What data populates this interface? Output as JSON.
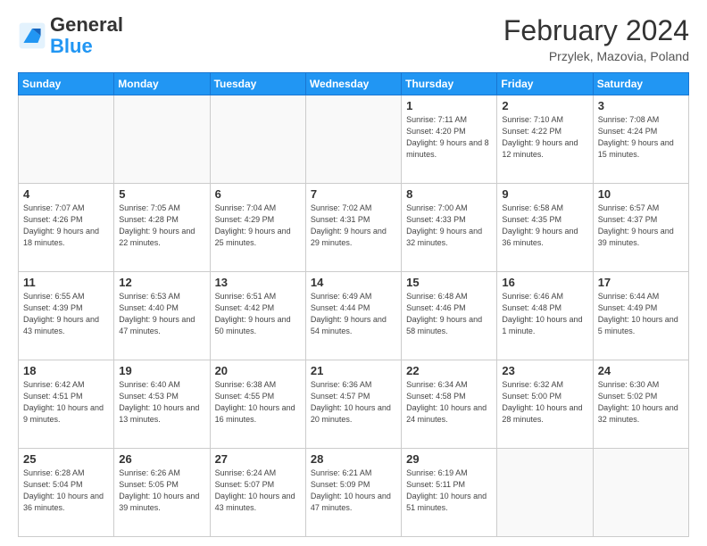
{
  "header": {
    "logo_general": "General",
    "logo_blue": "Blue",
    "month_year": "February 2024",
    "location": "Przylek, Mazovia, Poland"
  },
  "weekdays": [
    "Sunday",
    "Monday",
    "Tuesday",
    "Wednesday",
    "Thursday",
    "Friday",
    "Saturday"
  ],
  "weeks": [
    [
      {
        "day": "",
        "info": ""
      },
      {
        "day": "",
        "info": ""
      },
      {
        "day": "",
        "info": ""
      },
      {
        "day": "",
        "info": ""
      },
      {
        "day": "1",
        "info": "Sunrise: 7:11 AM\nSunset: 4:20 PM\nDaylight: 9 hours\nand 8 minutes."
      },
      {
        "day": "2",
        "info": "Sunrise: 7:10 AM\nSunset: 4:22 PM\nDaylight: 9 hours\nand 12 minutes."
      },
      {
        "day": "3",
        "info": "Sunrise: 7:08 AM\nSunset: 4:24 PM\nDaylight: 9 hours\nand 15 minutes."
      }
    ],
    [
      {
        "day": "4",
        "info": "Sunrise: 7:07 AM\nSunset: 4:26 PM\nDaylight: 9 hours\nand 18 minutes."
      },
      {
        "day": "5",
        "info": "Sunrise: 7:05 AM\nSunset: 4:28 PM\nDaylight: 9 hours\nand 22 minutes."
      },
      {
        "day": "6",
        "info": "Sunrise: 7:04 AM\nSunset: 4:29 PM\nDaylight: 9 hours\nand 25 minutes."
      },
      {
        "day": "7",
        "info": "Sunrise: 7:02 AM\nSunset: 4:31 PM\nDaylight: 9 hours\nand 29 minutes."
      },
      {
        "day": "8",
        "info": "Sunrise: 7:00 AM\nSunset: 4:33 PM\nDaylight: 9 hours\nand 32 minutes."
      },
      {
        "day": "9",
        "info": "Sunrise: 6:58 AM\nSunset: 4:35 PM\nDaylight: 9 hours\nand 36 minutes."
      },
      {
        "day": "10",
        "info": "Sunrise: 6:57 AM\nSunset: 4:37 PM\nDaylight: 9 hours\nand 39 minutes."
      }
    ],
    [
      {
        "day": "11",
        "info": "Sunrise: 6:55 AM\nSunset: 4:39 PM\nDaylight: 9 hours\nand 43 minutes."
      },
      {
        "day": "12",
        "info": "Sunrise: 6:53 AM\nSunset: 4:40 PM\nDaylight: 9 hours\nand 47 minutes."
      },
      {
        "day": "13",
        "info": "Sunrise: 6:51 AM\nSunset: 4:42 PM\nDaylight: 9 hours\nand 50 minutes."
      },
      {
        "day": "14",
        "info": "Sunrise: 6:49 AM\nSunset: 4:44 PM\nDaylight: 9 hours\nand 54 minutes."
      },
      {
        "day": "15",
        "info": "Sunrise: 6:48 AM\nSunset: 4:46 PM\nDaylight: 9 hours\nand 58 minutes."
      },
      {
        "day": "16",
        "info": "Sunrise: 6:46 AM\nSunset: 4:48 PM\nDaylight: 10 hours\nand 1 minute."
      },
      {
        "day": "17",
        "info": "Sunrise: 6:44 AM\nSunset: 4:49 PM\nDaylight: 10 hours\nand 5 minutes."
      }
    ],
    [
      {
        "day": "18",
        "info": "Sunrise: 6:42 AM\nSunset: 4:51 PM\nDaylight: 10 hours\nand 9 minutes."
      },
      {
        "day": "19",
        "info": "Sunrise: 6:40 AM\nSunset: 4:53 PM\nDaylight: 10 hours\nand 13 minutes."
      },
      {
        "day": "20",
        "info": "Sunrise: 6:38 AM\nSunset: 4:55 PM\nDaylight: 10 hours\nand 16 minutes."
      },
      {
        "day": "21",
        "info": "Sunrise: 6:36 AM\nSunset: 4:57 PM\nDaylight: 10 hours\nand 20 minutes."
      },
      {
        "day": "22",
        "info": "Sunrise: 6:34 AM\nSunset: 4:58 PM\nDaylight: 10 hours\nand 24 minutes."
      },
      {
        "day": "23",
        "info": "Sunrise: 6:32 AM\nSunset: 5:00 PM\nDaylight: 10 hours\nand 28 minutes."
      },
      {
        "day": "24",
        "info": "Sunrise: 6:30 AM\nSunset: 5:02 PM\nDaylight: 10 hours\nand 32 minutes."
      }
    ],
    [
      {
        "day": "25",
        "info": "Sunrise: 6:28 AM\nSunset: 5:04 PM\nDaylight: 10 hours\nand 36 minutes."
      },
      {
        "day": "26",
        "info": "Sunrise: 6:26 AM\nSunset: 5:05 PM\nDaylight: 10 hours\nand 39 minutes."
      },
      {
        "day": "27",
        "info": "Sunrise: 6:24 AM\nSunset: 5:07 PM\nDaylight: 10 hours\nand 43 minutes."
      },
      {
        "day": "28",
        "info": "Sunrise: 6:21 AM\nSunset: 5:09 PM\nDaylight: 10 hours\nand 47 minutes."
      },
      {
        "day": "29",
        "info": "Sunrise: 6:19 AM\nSunset: 5:11 PM\nDaylight: 10 hours\nand 51 minutes."
      },
      {
        "day": "",
        "info": ""
      },
      {
        "day": "",
        "info": ""
      }
    ]
  ]
}
